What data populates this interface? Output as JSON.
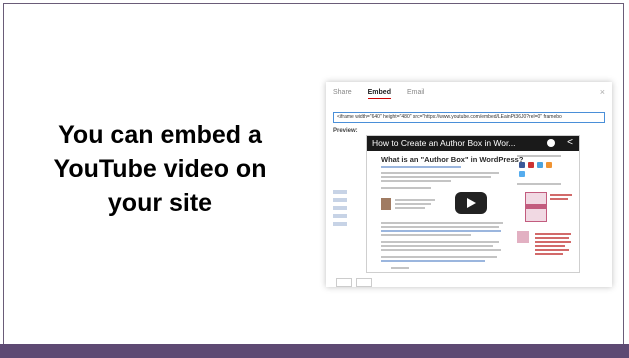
{
  "slide": {
    "text_line1": "You can embed a",
    "text_line2": "YouTube video on",
    "text_line3": "your site"
  },
  "dialog": {
    "tabs": [
      "Share",
      "Embed",
      "Email"
    ],
    "active_tab": "Embed",
    "embed_code": "<iframe width=\"640\" height=\"480\" src=\"https://www.youtube.com/embed/LEainPt36J0?rel=0\" framebo",
    "preview_label": "Preview:",
    "close_glyph": "×"
  },
  "video": {
    "title": "How to Create an Author Box in Wor...",
    "share_glyph": "<",
    "page_heading": "What is an \"Author Box\" in WordPress?"
  },
  "colors": {
    "footer_bar": "#5e4a73",
    "slide_border": "#6a5c78",
    "tab_underline": "#cc0000",
    "input_border": "#4a8fd8"
  }
}
